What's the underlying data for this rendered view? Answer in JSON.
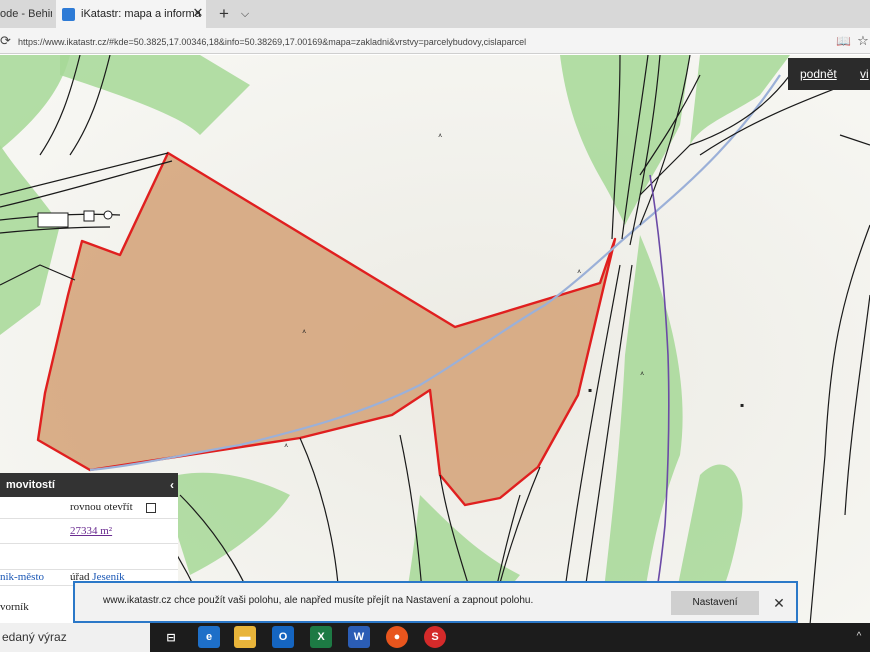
{
  "browser": {
    "inactive_tab_label": "ode - Behin",
    "active_tab_label": "iKatastr: mapa a informa",
    "close_glyph": "✕",
    "new_tab_glyph": "+",
    "tab_menu_glyph": "⌵",
    "url": "https://www.ikatastr.cz/#kde=50.3825,17.00346,18&info=50.38269,17.00169&mapa=zakladni&vrstvy=parcelybudovy,cislaparcel"
  },
  "map": {
    "buttons": {
      "podnet": "podnět",
      "vi": "vi"
    },
    "parcel_fill": "#d6a77f",
    "parcel_border": "#e01f1f",
    "forest_color": "#a6d896",
    "path_color": "#9bb0d8",
    "boundary_color": "#6b4aa6"
  },
  "panel": {
    "header": "movitostí",
    "collapse_glyph": "‹",
    "open_label": "rovnou otevřít",
    "area": "27334 m²",
    "municipality": "nik-město",
    "office_prefix": "úřad",
    "office_name": "Jeseník",
    "owner_label": "vorník"
  },
  "notification": {
    "text": "www.ikatastr.cz chce použít vaši polohu, ale napřed musíte přejít na Nastavení a zapnout polohu.",
    "settings_button": "Nastavení",
    "close_glyph": "✕"
  },
  "taskbar": {
    "search_placeholder": "edaný výraz",
    "icons": [
      {
        "name": "task-view-icon",
        "label": "⊟",
        "color": "#1c1c1c"
      },
      {
        "name": "edge-icon",
        "label": "e",
        "color": "#1e6fc8"
      },
      {
        "name": "file-explorer-icon",
        "label": "▬",
        "color": "#e8b43a"
      },
      {
        "name": "outlook-icon",
        "label": "O",
        "color": "#1565c0"
      },
      {
        "name": "excel-icon",
        "label": "X",
        "color": "#1d7a44"
      },
      {
        "name": "word-icon",
        "label": "W",
        "color": "#2b5db5"
      },
      {
        "name": "firefox-icon",
        "label": "●",
        "color": "#e8551d"
      },
      {
        "name": "app-s-icon",
        "label": "S",
        "color": "#d42a2a"
      }
    ],
    "chevron_glyph": "^"
  }
}
